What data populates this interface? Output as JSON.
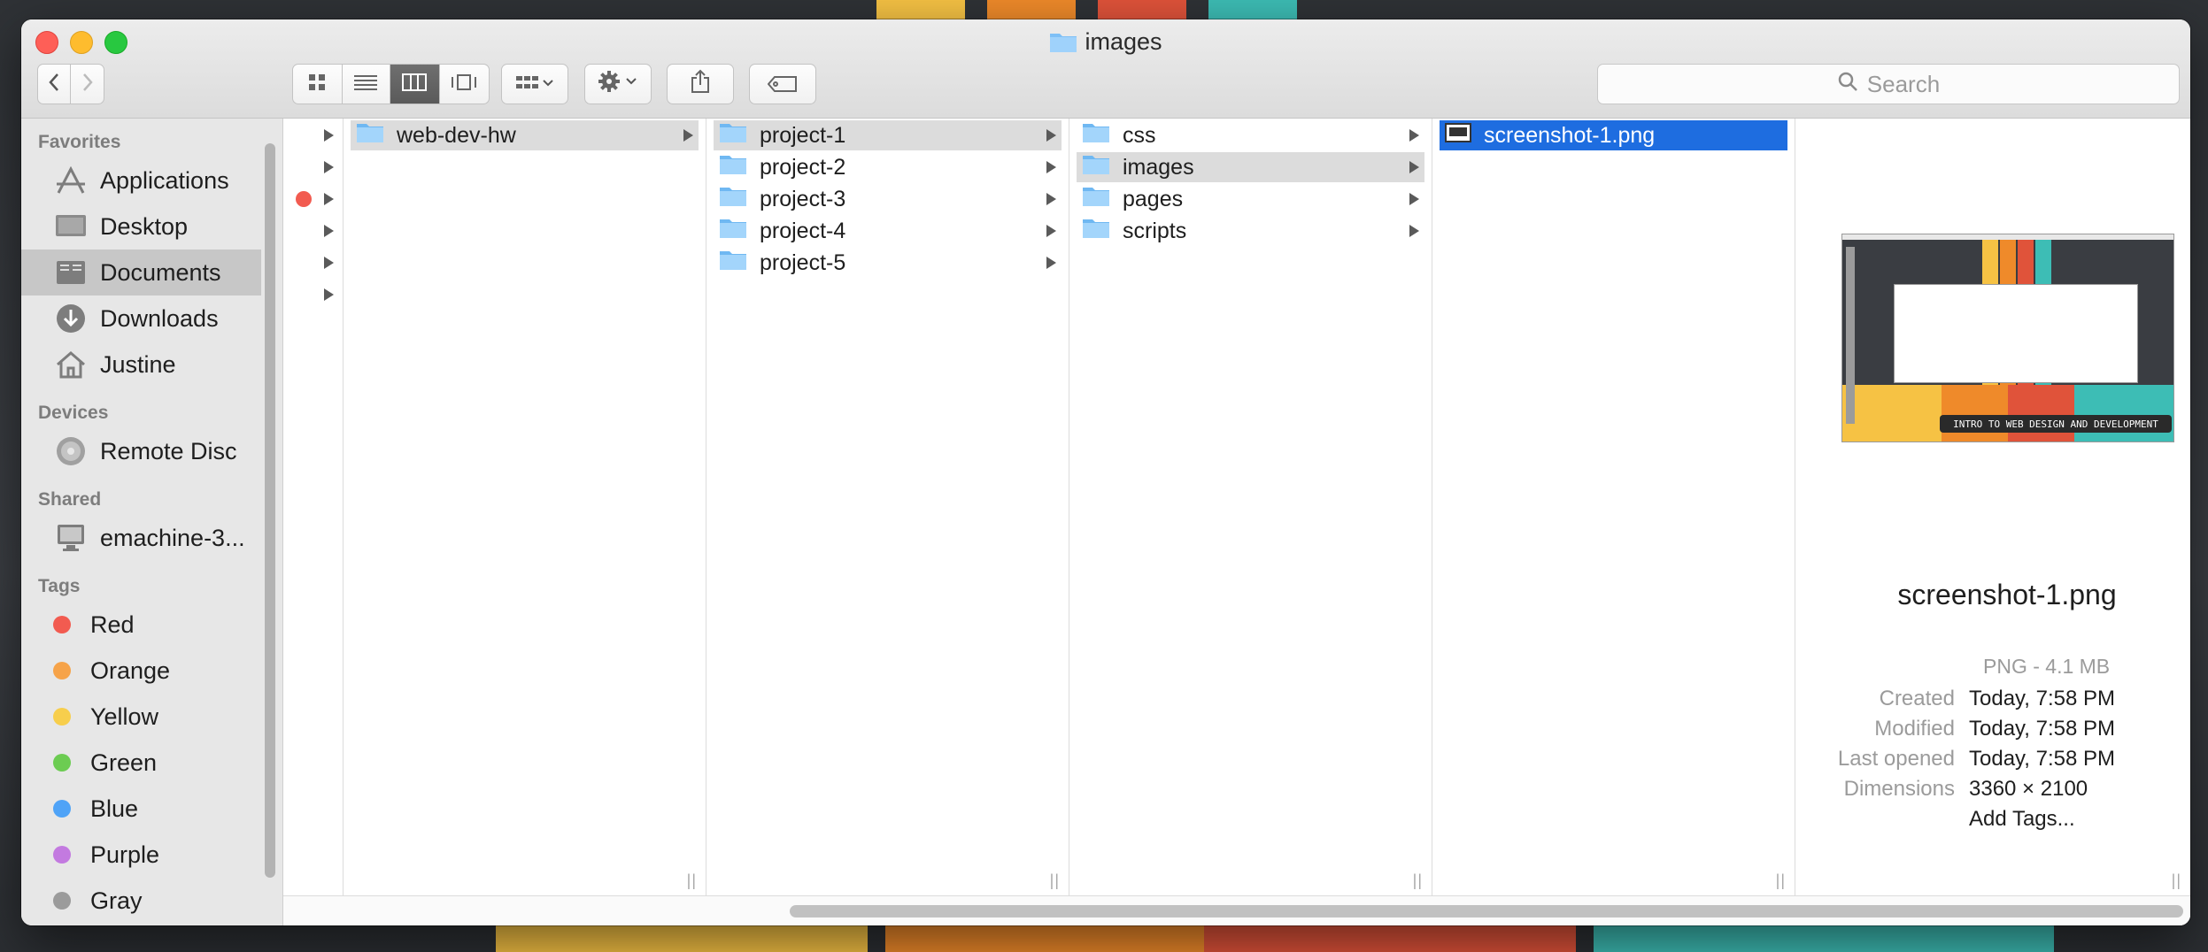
{
  "window": {
    "title": "images"
  },
  "toolbar": {
    "view_modes": [
      "icon-view",
      "list-view",
      "column-view",
      "cover-flow-view"
    ],
    "active_view": "column-view",
    "search_placeholder": "Search"
  },
  "sidebar": {
    "sections": [
      {
        "title": "Favorites",
        "items": [
          {
            "label": "Applications",
            "icon": "applications-icon"
          },
          {
            "label": "Desktop",
            "icon": "desktop-icon"
          },
          {
            "label": "Documents",
            "icon": "documents-icon",
            "selected": true
          },
          {
            "label": "Downloads",
            "icon": "downloads-icon"
          },
          {
            "label": "Justine",
            "icon": "home-icon"
          }
        ]
      },
      {
        "title": "Devices",
        "items": [
          {
            "label": "Remote Disc",
            "icon": "disc-icon"
          }
        ]
      },
      {
        "title": "Shared",
        "items": [
          {
            "label": "emachine-3...",
            "icon": "computer-icon"
          }
        ]
      },
      {
        "title": "Tags",
        "items": [
          {
            "label": "Red",
            "color": "#f25b50"
          },
          {
            "label": "Orange",
            "color": "#f6a349"
          },
          {
            "label": "Yellow",
            "color": "#f7ce4c"
          },
          {
            "label": "Green",
            "color": "#6ccc52"
          },
          {
            "label": "Blue",
            "color": "#4fa3f7"
          },
          {
            "label": "Purple",
            "color": "#c37ae0"
          },
          {
            "label": "Gray",
            "color": "#9b9b9b"
          }
        ]
      }
    ]
  },
  "columns": {
    "col0": {
      "items": [
        "",
        "",
        "",
        "",
        "",
        ""
      ],
      "tag_color": "#f25b50"
    },
    "col1": {
      "items": [
        "web-dev-hw"
      ]
    },
    "col2": {
      "items": [
        "project-1",
        "project-2",
        "project-3",
        "project-4",
        "project-5"
      ]
    },
    "col3": {
      "items": [
        "css",
        "images",
        "pages",
        "scripts"
      ]
    },
    "col4": {
      "items": [
        "screenshot-1.png"
      ]
    }
  },
  "preview": {
    "name": "screenshot-1.png",
    "kind": "PNG - 4.1 MB",
    "created_label": "Created",
    "created": "Today, 7:58 PM",
    "modified_label": "Modified",
    "modified": "Today, 7:58 PM",
    "last_opened_label": "Last opened",
    "last_opened": "Today, 7:58 PM",
    "dimensions_label": "Dimensions",
    "dimensions": "3360 × 2100",
    "add_tags": "Add Tags...",
    "thumb_caption": "INTRO TO WEB DESIGN AND DEVELOPMENT"
  }
}
